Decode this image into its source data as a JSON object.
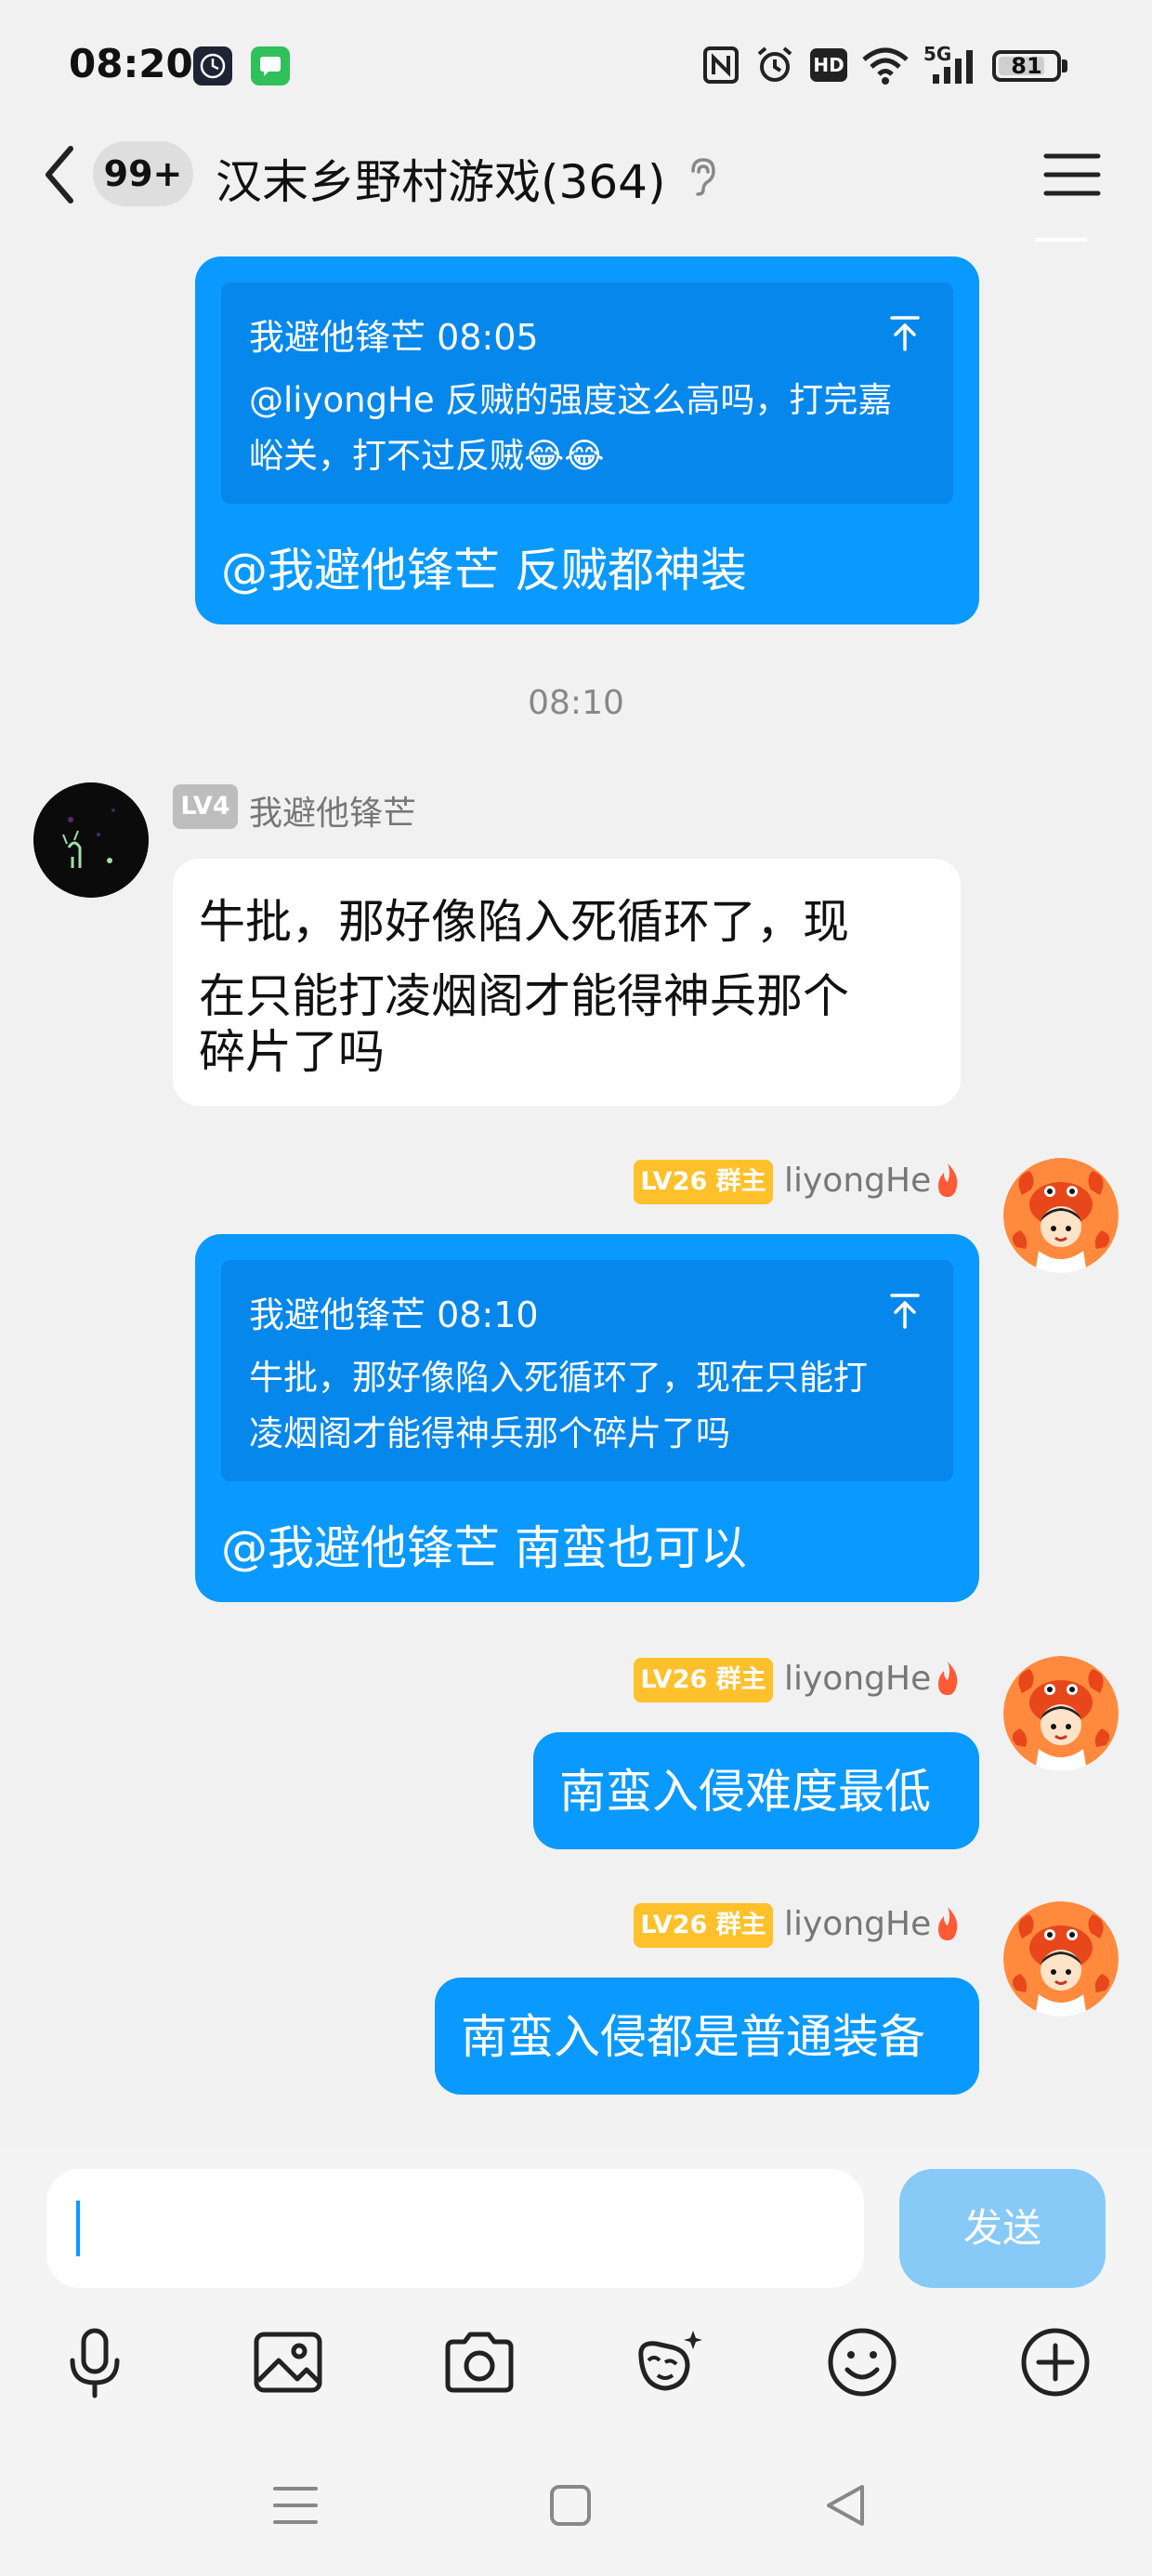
{
  "status_bar": {
    "time": "08:20",
    "network": "5G",
    "battery": 81,
    "battery_text": "81",
    "hd_label": "HD",
    "icons": [
      "clock-app-icon",
      "messages-app-icon",
      "nfc-icon",
      "alarm-icon",
      "hd-icon",
      "wifi-icon",
      "signal-icon",
      "battery-icon"
    ]
  },
  "header": {
    "unread_badge": "99+",
    "title": "汉末乡野村游戏(364)",
    "icons": [
      "back-icon",
      "ear-icon",
      "menu-icon"
    ]
  },
  "colors": {
    "bubble_blue": "#0a99ff",
    "quote_blue": "#0687ec",
    "send_disabled": "#87c9f7",
    "level_badge_owner": "#ffc12b",
    "level_badge_member": "#bdbdbd"
  },
  "messages": [
    {
      "side": "right",
      "quote": {
        "author_time": "我避他锋芒 08:05",
        "lines": [
          "@liyongHe 反贼的强度这么高吗，打完嘉",
          "峪关，打不过反贼😂😂"
        ]
      },
      "text": "@我避他锋芒 反贼都神装"
    },
    {
      "type": "time",
      "text": "08:10"
    },
    {
      "side": "left",
      "level": "LV4",
      "sender": "我避他锋芒",
      "lines": [
        "牛批，那好像陷入死循环了，现",
        "在只能打凌烟阁才能得神兵那个",
        "碎片了吗"
      ]
    },
    {
      "side": "right",
      "level": "LV26 群主",
      "sender": "liyongHe",
      "quote": {
        "author_time": "我避他锋芒 08:10",
        "lines": [
          "牛批，那好像陷入死循环了，现在只能打",
          "凌烟阁才能得神兵那个碎片了吗"
        ]
      },
      "text": "@我避他锋芒 南蛮也可以"
    },
    {
      "side": "right",
      "level": "LV26 群主",
      "sender": "liyongHe",
      "text": "南蛮入侵难度最低"
    },
    {
      "side": "right",
      "level": "LV26 群主",
      "sender": "liyongHe",
      "text": "南蛮入侵都是普通装备"
    }
  ],
  "input": {
    "value": "",
    "send_label": "发送"
  },
  "toolbar": [
    "microphone-icon",
    "image-icon",
    "camera-icon",
    "sticker-icon",
    "emoji-icon",
    "plus-icon"
  ],
  "nav_bar": [
    "menu-nav-icon",
    "home-nav-icon",
    "back-nav-icon"
  ]
}
